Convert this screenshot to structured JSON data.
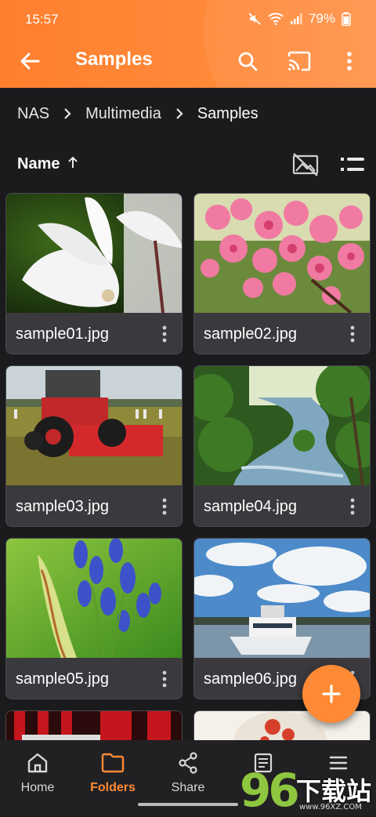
{
  "status_bar": {
    "time": "15:57",
    "battery": "79%",
    "icons": [
      "mute-icon",
      "wifi-icon",
      "signal-icon",
      "battery-icon"
    ]
  },
  "app_bar": {
    "title": "Samples",
    "actions": [
      "search-icon",
      "cast-icon",
      "more-vert-icon"
    ]
  },
  "breadcrumb": {
    "items": [
      "NAS",
      "Multimedia",
      "Samples"
    ]
  },
  "sort": {
    "label": "Name",
    "direction": "ascending"
  },
  "files": [
    {
      "name": "sample01.jpg"
    },
    {
      "name": "sample02.jpg"
    },
    {
      "name": "sample03.jpg"
    },
    {
      "name": "sample04.jpg"
    },
    {
      "name": "sample05.jpg"
    },
    {
      "name": "sample06.jpg"
    },
    {
      "name": ""
    },
    {
      "name": ""
    }
  ],
  "bottom_nav": {
    "items": [
      {
        "label": "Home",
        "icon": "home-icon",
        "active": false
      },
      {
        "label": "Folders",
        "icon": "folder-icon",
        "active": true
      },
      {
        "label": "Share",
        "icon": "share-icon",
        "active": false
      },
      {
        "label": "",
        "icon": "tasks-icon",
        "active": false
      },
      {
        "label": "",
        "icon": "menu-icon",
        "active": false
      }
    ]
  },
  "watermark": {
    "number": "96",
    "text": "下载站",
    "url": "www.96XZ.COM"
  },
  "colors": {
    "accent": "#ff8a35",
    "background": "#1b1b1d",
    "card": "#3a393d"
  }
}
